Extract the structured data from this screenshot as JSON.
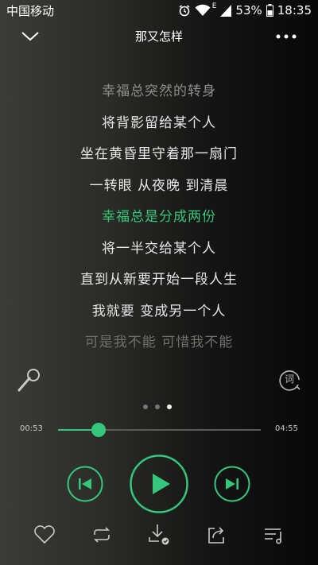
{
  "status_bar": {
    "carrier": "中国移动",
    "network_badge": "E",
    "battery": "53%",
    "time": "18:35",
    "icons": [
      "alarm-icon",
      "wifi-icon",
      "signal-icon",
      "battery-icon"
    ]
  },
  "header": {
    "title": "那又怎样",
    "icons": [
      "chevron-down-icon",
      "more-icon"
    ]
  },
  "lyrics": [
    "幸福总突然的转身",
    "将背影留给某个人",
    "坐在黄昏里守着那一扇门",
    "一转眼 从夜晚 到清晨",
    "幸福总是分成两份",
    "将一半交给某个人",
    "直到从新要开始一段人生",
    "我就要 变成另一个人",
    "可是我不能 可惜我不能"
  ],
  "active_lyric_index": 4,
  "side_buttons": {
    "lyrics_label": "词",
    "icons": [
      "microphone-icon",
      "lyrics-icon"
    ]
  },
  "page_indicator": {
    "count": 3,
    "active": 2
  },
  "progress": {
    "current": "00:53",
    "total": "04:55",
    "fraction": 0.2
  },
  "controls": {
    "icons": [
      "previous-icon",
      "play-icon",
      "next-icon"
    ]
  },
  "bottom_bar": {
    "icons": [
      "heart-icon",
      "repeat-icon",
      "download-icon",
      "share-icon",
      "playlist-icon"
    ]
  },
  "colors": {
    "accent": "#34c77b",
    "text": "#ffffff",
    "dim_text": "#8e8f8b"
  }
}
